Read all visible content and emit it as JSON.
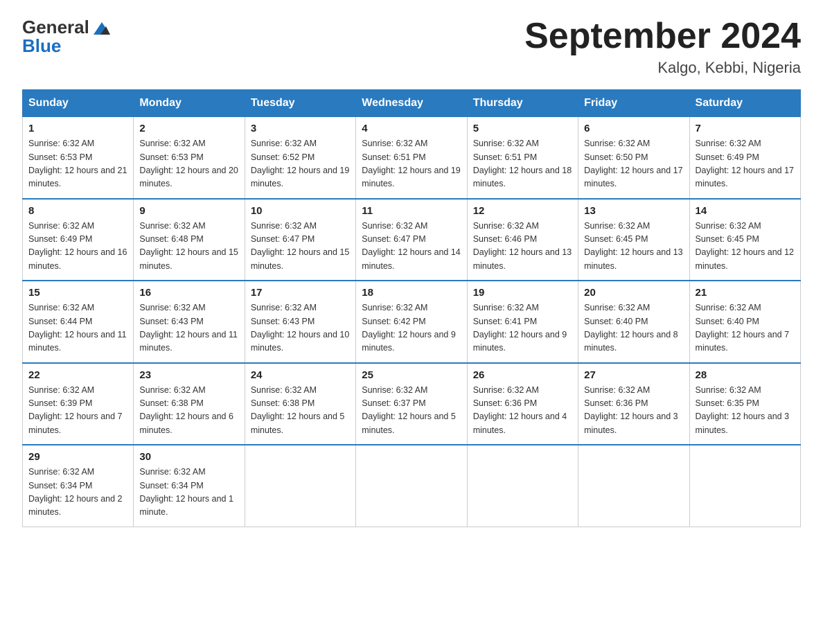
{
  "logo": {
    "general": "General",
    "blue": "Blue"
  },
  "title": "September 2024",
  "subtitle": "Kalgo, Kebbi, Nigeria",
  "headers": [
    "Sunday",
    "Monday",
    "Tuesday",
    "Wednesday",
    "Thursday",
    "Friday",
    "Saturday"
  ],
  "weeks": [
    [
      {
        "day": "1",
        "sunrise": "6:32 AM",
        "sunset": "6:53 PM",
        "daylight": "12 hours and 21 minutes."
      },
      {
        "day": "2",
        "sunrise": "6:32 AM",
        "sunset": "6:53 PM",
        "daylight": "12 hours and 20 minutes."
      },
      {
        "day": "3",
        "sunrise": "6:32 AM",
        "sunset": "6:52 PM",
        "daylight": "12 hours and 19 minutes."
      },
      {
        "day": "4",
        "sunrise": "6:32 AM",
        "sunset": "6:51 PM",
        "daylight": "12 hours and 19 minutes."
      },
      {
        "day": "5",
        "sunrise": "6:32 AM",
        "sunset": "6:51 PM",
        "daylight": "12 hours and 18 minutes."
      },
      {
        "day": "6",
        "sunrise": "6:32 AM",
        "sunset": "6:50 PM",
        "daylight": "12 hours and 17 minutes."
      },
      {
        "day": "7",
        "sunrise": "6:32 AM",
        "sunset": "6:49 PM",
        "daylight": "12 hours and 17 minutes."
      }
    ],
    [
      {
        "day": "8",
        "sunrise": "6:32 AM",
        "sunset": "6:49 PM",
        "daylight": "12 hours and 16 minutes."
      },
      {
        "day": "9",
        "sunrise": "6:32 AM",
        "sunset": "6:48 PM",
        "daylight": "12 hours and 15 minutes."
      },
      {
        "day": "10",
        "sunrise": "6:32 AM",
        "sunset": "6:47 PM",
        "daylight": "12 hours and 15 minutes."
      },
      {
        "day": "11",
        "sunrise": "6:32 AM",
        "sunset": "6:47 PM",
        "daylight": "12 hours and 14 minutes."
      },
      {
        "day": "12",
        "sunrise": "6:32 AM",
        "sunset": "6:46 PM",
        "daylight": "12 hours and 13 minutes."
      },
      {
        "day": "13",
        "sunrise": "6:32 AM",
        "sunset": "6:45 PM",
        "daylight": "12 hours and 13 minutes."
      },
      {
        "day": "14",
        "sunrise": "6:32 AM",
        "sunset": "6:45 PM",
        "daylight": "12 hours and 12 minutes."
      }
    ],
    [
      {
        "day": "15",
        "sunrise": "6:32 AM",
        "sunset": "6:44 PM",
        "daylight": "12 hours and 11 minutes."
      },
      {
        "day": "16",
        "sunrise": "6:32 AM",
        "sunset": "6:43 PM",
        "daylight": "12 hours and 11 minutes."
      },
      {
        "day": "17",
        "sunrise": "6:32 AM",
        "sunset": "6:43 PM",
        "daylight": "12 hours and 10 minutes."
      },
      {
        "day": "18",
        "sunrise": "6:32 AM",
        "sunset": "6:42 PM",
        "daylight": "12 hours and 9 minutes."
      },
      {
        "day": "19",
        "sunrise": "6:32 AM",
        "sunset": "6:41 PM",
        "daylight": "12 hours and 9 minutes."
      },
      {
        "day": "20",
        "sunrise": "6:32 AM",
        "sunset": "6:40 PM",
        "daylight": "12 hours and 8 minutes."
      },
      {
        "day": "21",
        "sunrise": "6:32 AM",
        "sunset": "6:40 PM",
        "daylight": "12 hours and 7 minutes."
      }
    ],
    [
      {
        "day": "22",
        "sunrise": "6:32 AM",
        "sunset": "6:39 PM",
        "daylight": "12 hours and 7 minutes."
      },
      {
        "day": "23",
        "sunrise": "6:32 AM",
        "sunset": "6:38 PM",
        "daylight": "12 hours and 6 minutes."
      },
      {
        "day": "24",
        "sunrise": "6:32 AM",
        "sunset": "6:38 PM",
        "daylight": "12 hours and 5 minutes."
      },
      {
        "day": "25",
        "sunrise": "6:32 AM",
        "sunset": "6:37 PM",
        "daylight": "12 hours and 5 minutes."
      },
      {
        "day": "26",
        "sunrise": "6:32 AM",
        "sunset": "6:36 PM",
        "daylight": "12 hours and 4 minutes."
      },
      {
        "day": "27",
        "sunrise": "6:32 AM",
        "sunset": "6:36 PM",
        "daylight": "12 hours and 3 minutes."
      },
      {
        "day": "28",
        "sunrise": "6:32 AM",
        "sunset": "6:35 PM",
        "daylight": "12 hours and 3 minutes."
      }
    ],
    [
      {
        "day": "29",
        "sunrise": "6:32 AM",
        "sunset": "6:34 PM",
        "daylight": "12 hours and 2 minutes."
      },
      {
        "day": "30",
        "sunrise": "6:32 AM",
        "sunset": "6:34 PM",
        "daylight": "12 hours and 1 minute."
      },
      null,
      null,
      null,
      null,
      null
    ]
  ]
}
